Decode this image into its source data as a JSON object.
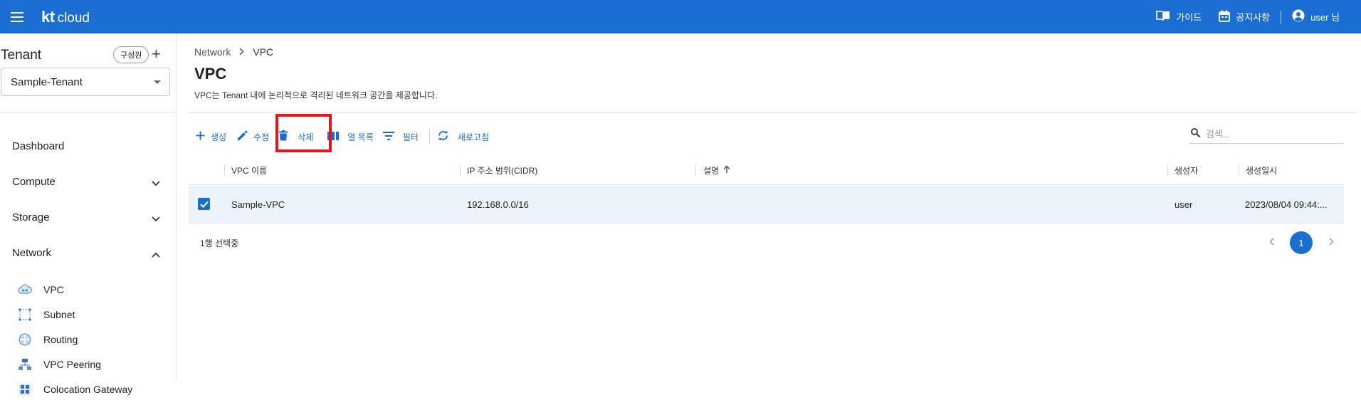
{
  "header": {
    "logo_kt": "kt",
    "logo_cloud": "cloud",
    "guide_label": "가이드",
    "notice_label": "공지사항",
    "user_label": "user 님",
    "brand_color": "#1a6ed2"
  },
  "sidebar": {
    "tenant_title": "Tenant",
    "member_chip": "구성원",
    "tenant_selected": "Sample-Tenant",
    "nav": {
      "dashboard": "Dashboard",
      "compute": "Compute",
      "storage": "Storage",
      "network": "Network"
    },
    "network_sub": {
      "vpc": "VPC",
      "subnet": "Subnet",
      "routing": "Routing",
      "vpc_peering": "VPC Peering",
      "colocation": "Colocation Gateway"
    }
  },
  "main": {
    "breadcrumb_parent": "Network",
    "breadcrumb_current": "VPC",
    "title": "VPC",
    "description": "VPC는 Tenant 내에 논리적으로 격리된 네트워크 공간을 제공합니다.",
    "toolbar": {
      "create": "생성",
      "edit": "수정",
      "delete": "삭제",
      "columns": "열 목록",
      "filter": "필터",
      "refresh": "새로고침"
    },
    "search_placeholder": "검색...",
    "table": {
      "headers": {
        "name": "VPC 이름",
        "cidr": "IP 주소 범위(CIDR)",
        "desc": "설명",
        "creator": "생성자",
        "created": "생성일시"
      },
      "rows": [
        {
          "name": "Sample-VPC",
          "cidr": "192.168.0.0/16",
          "desc": "",
          "creator": "user",
          "created": "2023/08/04 09:44:..."
        }
      ]
    },
    "selection_text": "1행 선택중",
    "page": "1"
  }
}
